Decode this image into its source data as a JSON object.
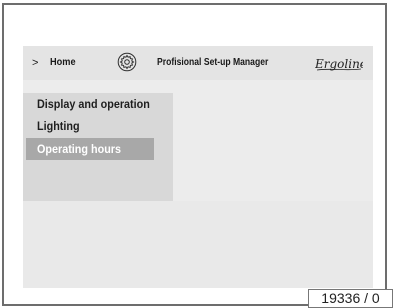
{
  "header": {
    "breadcrumb_arrow": ">",
    "breadcrumb_home": "Home",
    "title": "Profisional Set-up Manager",
    "icon": "gear-icon",
    "logo_text": "Ergoline"
  },
  "menu": {
    "items": [
      {
        "label": "Display and operation",
        "selected": false
      },
      {
        "label": "Lighting",
        "selected": false
      },
      {
        "label": "Operating hours",
        "selected": true
      }
    ]
  },
  "figure_number": "19336 / 0",
  "colors": {
    "frame": "#6d6d6d",
    "screen_background": "#ececec",
    "header_background": "#e4e4e4",
    "menu_background": "#d8d8d8",
    "selected_item_background": "#a8a8a8",
    "selected_item_text": "#ffffff",
    "text": "#1f1f1f"
  }
}
